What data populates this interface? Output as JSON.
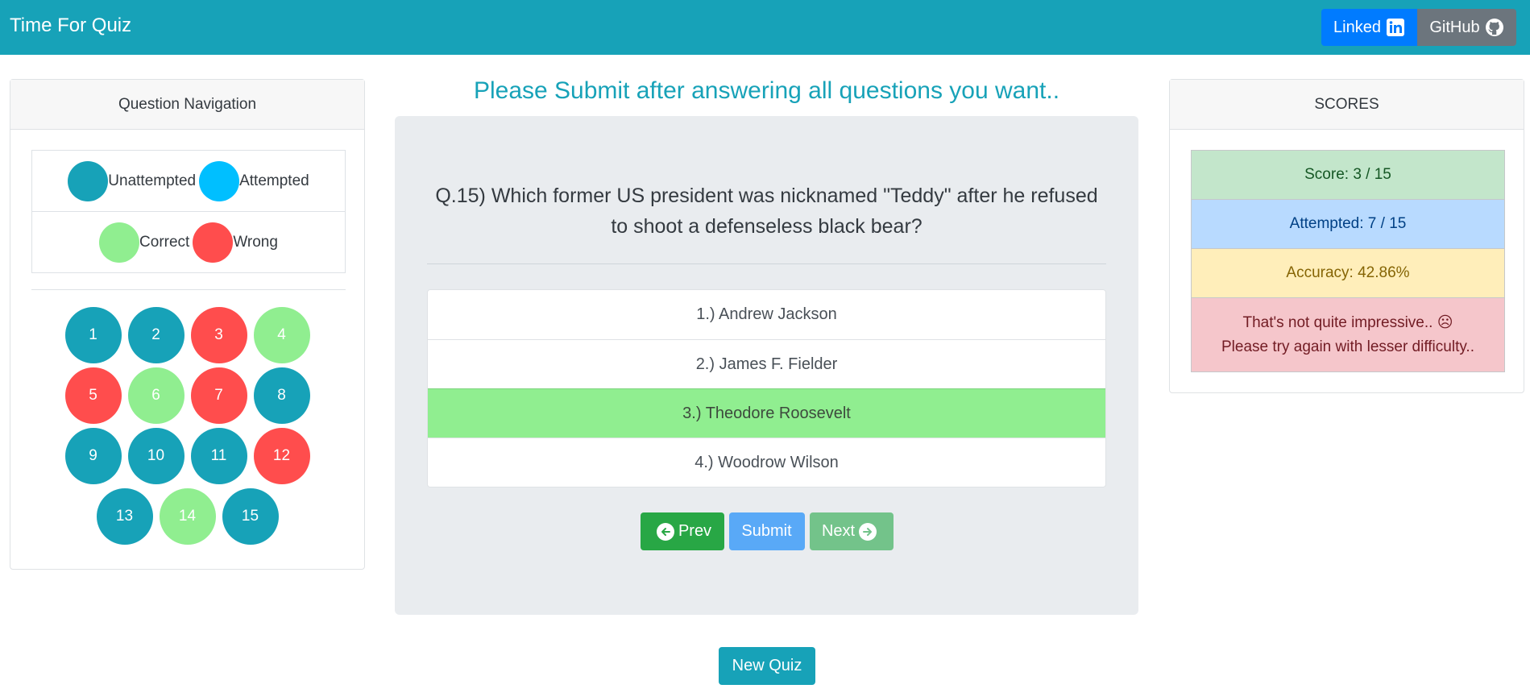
{
  "navbar": {
    "brand": "Time For Quiz",
    "linkedin_label": "Linked",
    "github_label": "GitHub",
    "colors": {
      "bg": "#17a2b8",
      "linkedin": "#007bff",
      "github": "#6c757d"
    }
  },
  "left_panel": {
    "title": "Question Navigation",
    "legend": [
      {
        "label": "Unattempted",
        "color": "#17a2b8"
      },
      {
        "label": "Attempted",
        "color": "#00bfff"
      },
      {
        "label": "Correct",
        "color": "#90ee90"
      },
      {
        "label": "Wrong",
        "color": "#ff4d4d"
      }
    ],
    "questions": [
      {
        "num": "1",
        "status": "unattempted"
      },
      {
        "num": "2",
        "status": "unattempted"
      },
      {
        "num": "3",
        "status": "wrong"
      },
      {
        "num": "4",
        "status": "correct"
      },
      {
        "num": "5",
        "status": "wrong"
      },
      {
        "num": "6",
        "status": "correct"
      },
      {
        "num": "7",
        "status": "wrong"
      },
      {
        "num": "8",
        "status": "unattempted"
      },
      {
        "num": "9",
        "status": "unattempted"
      },
      {
        "num": "10",
        "status": "unattempted"
      },
      {
        "num": "11",
        "status": "unattempted"
      },
      {
        "num": "12",
        "status": "wrong"
      },
      {
        "num": "13",
        "status": "unattempted"
      },
      {
        "num": "14",
        "status": "correct"
      },
      {
        "num": "15",
        "status": "unattempted"
      }
    ]
  },
  "main": {
    "headline": "Please Submit after answering all questions you want..",
    "question": "Q.15) Which former US president was nicknamed \"Teddy\" after he refused to shoot a defenseless black bear?",
    "options": [
      {
        "label": "1.) Andrew Jackson",
        "state": "normal"
      },
      {
        "label": "2.) James F. Fielder",
        "state": "normal"
      },
      {
        "label": "3.) Theodore Roosevelt",
        "state": "correct"
      },
      {
        "label": "4.) Woodrow Wilson",
        "state": "normal"
      }
    ],
    "prev_label": "Prev",
    "submit_label": "Submit",
    "next_label": "Next",
    "new_quiz_label": "New Quiz"
  },
  "right_panel": {
    "title": "SCORES",
    "score": "Score: 3 / 15",
    "attempted": "Attempted: 7 / 15",
    "accuracy": "Accuracy: 42.86%",
    "message_line1": "That's not quite impressive.. ☹",
    "message_line2": "Please try again with lesser difficulty.."
  },
  "status_colors": {
    "unattempted": "#17a2b8",
    "attempted": "#00bfff",
    "correct": "#90ee90",
    "wrong": "#ff4d4d"
  }
}
